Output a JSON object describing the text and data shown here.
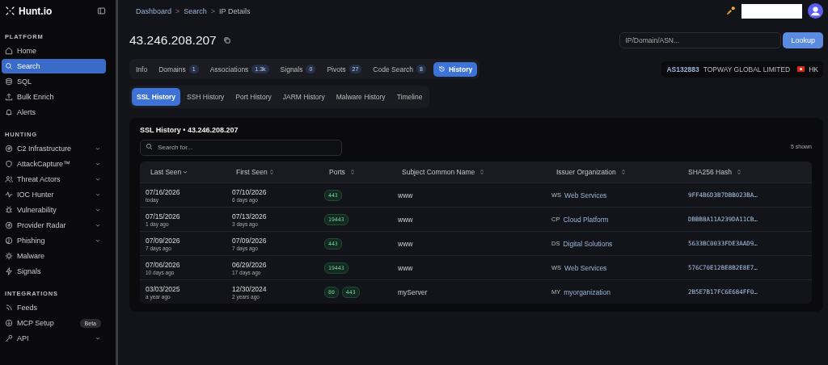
{
  "brand": "Hunt.io",
  "sidebar": [
    {
      "heading": "PLATFORM",
      "items": [
        {
          "label": "Home",
          "selected": false,
          "expandable": false
        },
        {
          "label": "Search",
          "selected": true,
          "expandable": false
        },
        {
          "label": "SQL",
          "selected": false,
          "expandable": false
        },
        {
          "label": "Bulk Enrich",
          "selected": false,
          "expandable": false
        },
        {
          "label": "Alerts",
          "selected": false,
          "expandable": false
        }
      ]
    },
    {
      "heading": "HUNTING",
      "items": [
        {
          "label": "C2 Infrastructure",
          "selected": false,
          "expandable": true
        },
        {
          "label": "AttackCapture™",
          "selected": false,
          "expandable": true
        },
        {
          "label": "Threat Actors",
          "selected": false,
          "expandable": true
        },
        {
          "label": "IOC Hunter",
          "selected": false,
          "expandable": true
        },
        {
          "label": "Vulnerability",
          "selected": false,
          "expandable": true
        },
        {
          "label": "Provider Radar",
          "selected": false,
          "expandable": true
        },
        {
          "label": "Phishing",
          "selected": false,
          "expandable": true
        },
        {
          "label": "Malware",
          "selected": false,
          "expandable": false
        },
        {
          "label": "Signals",
          "selected": false,
          "expandable": false
        }
      ]
    },
    {
      "heading": "INTEGRATIONS",
      "items": [
        {
          "label": "Feeds",
          "selected": false,
          "expandable": false
        },
        {
          "label": "MCP Setup",
          "selected": false,
          "expandable": false,
          "badge": "Beta"
        },
        {
          "label": "API",
          "selected": false,
          "expandable": true
        }
      ]
    }
  ],
  "breadcrumb": [
    "Dashboard",
    "Search",
    "IP Details"
  ],
  "breadcrumb_separator": ">",
  "title": "43.246.208.207",
  "lookup": {
    "placeholder": "IP/Domain/ASN...",
    "button": "Lookup"
  },
  "tabs": [
    {
      "label": "Info",
      "selected": false
    },
    {
      "label": "Domains",
      "count": "1",
      "selected": false
    },
    {
      "label": "Associations",
      "count": "1.3k",
      "selected": false
    },
    {
      "label": "Signals",
      "count": "0",
      "selected": false
    },
    {
      "label": "Pivots",
      "count": "27",
      "selected": false
    },
    {
      "label": "Code Search",
      "count": "8",
      "selected": false
    },
    {
      "label": "History",
      "selected": true
    }
  ],
  "asn": {
    "number": "AS132883",
    "name": "TOPWAY GLOBAL LIMITED",
    "country": "HK"
  },
  "subtabs": [
    {
      "label": "SSL History",
      "selected": true
    },
    {
      "label": "SSH History",
      "selected": false
    },
    {
      "label": "Port History",
      "selected": false
    },
    {
      "label": "JARM History",
      "selected": false
    },
    {
      "label": "Malware History",
      "selected": false
    },
    {
      "label": "Timeline",
      "selected": false
    }
  ],
  "card": {
    "title": "SSL History • 43.246.208.207",
    "search_placeholder": "Search for...",
    "count": "5 shown"
  },
  "table": {
    "columns": [
      {
        "label": "Last Seen",
        "sorted": true
      },
      {
        "label": "First Seen",
        "sorted": false
      },
      {
        "label": "Ports",
        "sorted": false
      },
      {
        "label": "Subject Common Name",
        "sorted": false
      },
      {
        "label": "Issuer Organization",
        "sorted": false
      },
      {
        "label": "SHA256 Hash",
        "sorted": false
      }
    ],
    "rows": [
      {
        "last_seen": "07/16/2026",
        "last_ago": "today",
        "first_seen": "07/10/2026",
        "first_ago": "6 days ago",
        "ports": [
          "443"
        ],
        "subject": "www",
        "issuer_abbr": "WS",
        "issuer": "Web Services",
        "hash": "9FF4B6D3B7DBB023BA…"
      },
      {
        "last_seen": "07/15/2026",
        "last_ago": "1 day ago",
        "first_seen": "07/13/2026",
        "first_ago": "3 days ago",
        "ports": [
          "19443"
        ],
        "subject": "www",
        "issuer_abbr": "CP",
        "issuer": "Cloud Platform",
        "hash": "DBBB8A11A239DA11CB…"
      },
      {
        "last_seen": "07/09/2026",
        "last_ago": "7 days ago",
        "first_seen": "07/09/2026",
        "first_ago": "7 days ago",
        "ports": [
          "443"
        ],
        "subject": "www",
        "issuer_abbr": "DS",
        "issuer": "Digital Solutions",
        "hash": "5633BC0033FDE3AAD9…"
      },
      {
        "last_seen": "07/06/2026",
        "last_ago": "10 days ago",
        "first_seen": "06/29/2026",
        "first_ago": "17 days ago",
        "ports": [
          "19443"
        ],
        "subject": "www",
        "issuer_abbr": "WS",
        "issuer": "Web Services",
        "hash": "576C70E12BE8B2E8E7…"
      },
      {
        "last_seen": "03/03/2025",
        "last_ago": "a year ago",
        "first_seen": "12/30/2024",
        "first_ago": "2 years ago",
        "ports": [
          "80",
          "443"
        ],
        "subject": "myServer",
        "issuer_abbr": "MY",
        "issuer": "myorganization",
        "hash": "2B5E7B17FC6E684FF0…"
      }
    ]
  }
}
